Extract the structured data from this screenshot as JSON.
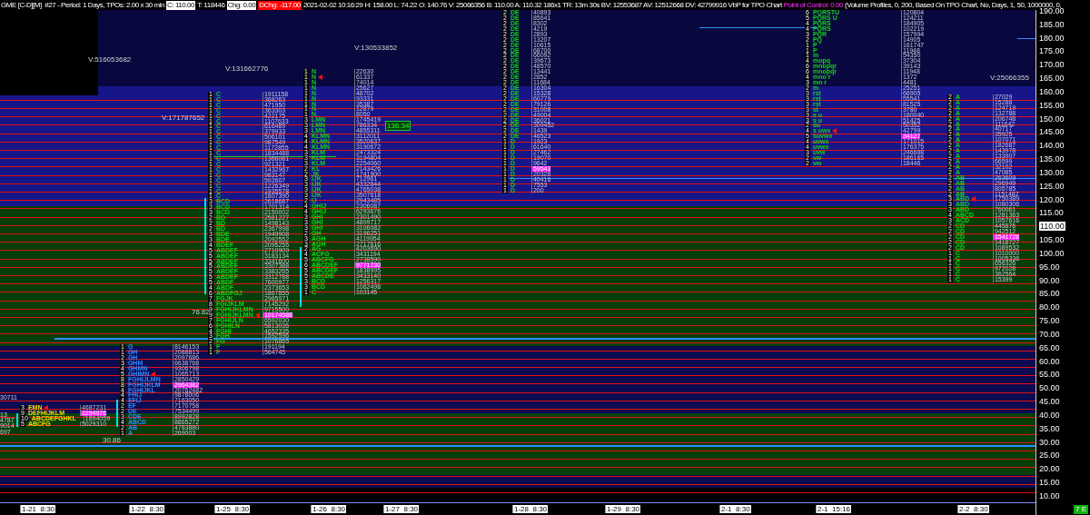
{
  "header": {
    "symbol": "GME [C-D][M]  #27 - Period: 1 Days, TPOs: 2.00 x 30 min",
    "close": "C: 110.00",
    "ticks": "T: 118446",
    "change": "Chg: 0.00",
    "day_change": "DChg: -117.00",
    "stats": "2021-02-02 10:16:29 H: 158.00 L: 74.22 O: 140.76 V: 25066356 B: 110.00 A: 110.32 186x1 TR: 13m 30s BV: 12553687 AV: 12512668 DV: 42799916 VbP for TPO Chart",
    "poc": "Point of Control: 0.00",
    "settings": "(Volume Profiles, 0, 200, Based On TPO Chart, No, Days, 1, 50, 1000000, 0,"
  },
  "left_edge_labels": [
    "30711",
    "13",
    "4787",
    "9014",
    "697"
  ],
  "profiles": [
    {
      "rows": [
        {
          "count": "3",
          "letters": "EMN",
          "volume": "4687231",
          "poc": false,
          "marker": true
        },
        {
          "count": "9",
          "letters": "DEFHIJKLM",
          "volume": "2294976",
          "poc": true,
          "marker": false
        },
        {
          "count": "10",
          "letters": "ABCDEFGHKL",
          "volume": "1894059",
          "poc": false,
          "marker": false
        },
        {
          "count": "5",
          "letters": "ABCFG",
          "volume": "5029310",
          "poc": false,
          "marker": false
        }
      ]
    },
    {
      "rows": [
        {
          "count": "1",
          "letters": "G",
          "volume": "8146153",
          "poc": false,
          "marker": false
        },
        {
          "count": "1",
          "letters": "GH",
          "volume": "2088813",
          "poc": false,
          "marker": false
        },
        {
          "count": "2",
          "letters": "GH",
          "volume": "2097686",
          "poc": false,
          "marker": false
        },
        {
          "count": "3",
          "letters": "GHM",
          "volume": "6638768",
          "poc": false,
          "marker": false
        },
        {
          "count": "4",
          "letters": "GHMN",
          "volume": "9306798",
          "poc": false,
          "marker": false
        },
        {
          "count": "5",
          "letters": "GHIMN",
          "volume": "1065713",
          "poc": false,
          "marker": true
        },
        {
          "count": "8",
          "letters": "FGHIJLMN",
          "volume": "2850429",
          "poc": false,
          "marker": false
        },
        {
          "count": "8",
          "letters": "FGHIJKLM",
          "volume": "2964382",
          "poc": true,
          "marker": false
        },
        {
          "count": "4",
          "letters": "FGHIJKL",
          "volume": "20762482",
          "poc": false,
          "marker": false
        },
        {
          "count": "4",
          "letters": "FHIJ",
          "volume": "9878006",
          "poc": false,
          "marker": false
        },
        {
          "count": "4",
          "letters": "EFIJ",
          "volume": "7163050",
          "poc": false,
          "marker": false
        },
        {
          "count": "2",
          "letters": "EF",
          "volume": "7170758",
          "poc": false,
          "marker": false
        },
        {
          "count": "2",
          "letters": "DE",
          "volume": "7534499",
          "poc": false,
          "marker": false
        },
        {
          "count": "3",
          "letters": "CDE",
          "volume": "8992828",
          "poc": false,
          "marker": false
        },
        {
          "count": "4",
          "letters": "ABCD",
          "volume": "8865272",
          "poc": false,
          "marker": false
        },
        {
          "count": "2",
          "letters": "AB",
          "volume": "4783880",
          "poc": false,
          "marker": false
        },
        {
          "count": "1",
          "letters": "A",
          "volume": "269003",
          "poc": false,
          "marker": false
        }
      ]
    },
    {
      "rows": [
        {
          "count": "1",
          "letters": "C",
          "volume": "1911158",
          "poc": false,
          "marker": false
        },
        {
          "count": "1",
          "letters": "C",
          "volume": "368263",
          "poc": false,
          "marker": false
        },
        {
          "count": "1",
          "letters": "C",
          "volume": "471950",
          "poc": false,
          "marker": false
        },
        {
          "count": "1",
          "letters": "C",
          "volume": "363303",
          "poc": false,
          "marker": false
        },
        {
          "count": "1",
          "letters": "C",
          "volume": "422175",
          "poc": false,
          "marker": false
        },
        {
          "count": "1",
          "letters": "C",
          "volume": "1107633",
          "poc": false,
          "marker": false
        },
        {
          "count": "1",
          "letters": "C",
          "volume": "616489",
          "poc": false,
          "marker": false
        },
        {
          "count": "1",
          "letters": "C",
          "volume": "379933",
          "poc": false,
          "marker": false
        },
        {
          "count": "1",
          "letters": "C",
          "volume": "506101",
          "poc": false,
          "marker": false
        },
        {
          "count": "1",
          "letters": "C",
          "volume": "987549",
          "poc": false,
          "marker": false
        },
        {
          "count": "1",
          "letters": "C",
          "volume": "1172855",
          "poc": false,
          "marker": false
        },
        {
          "count": "1",
          "letters": "C",
          "volume": "1834488",
          "poc": false,
          "marker": false
        },
        {
          "count": "1",
          "letters": "C",
          "volume": "1366081",
          "poc": false,
          "marker": false
        },
        {
          "count": "1",
          "letters": "C",
          "volume": "921321",
          "poc": false,
          "marker": false
        },
        {
          "count": "1",
          "letters": "C",
          "volume": "1432967",
          "poc": false,
          "marker": false
        },
        {
          "count": "1",
          "letters": "C",
          "volume": "983147",
          "poc": false,
          "marker": false
        },
        {
          "count": "1",
          "letters": "C",
          "volume": "592607",
          "poc": false,
          "marker": false
        },
        {
          "count": "1",
          "letters": "C",
          "volume": "1226349",
          "poc": false,
          "marker": false
        },
        {
          "count": "1",
          "letters": "C",
          "volume": "1935578",
          "poc": false,
          "marker": false
        },
        {
          "count": "1",
          "letters": "C",
          "volume": "1807390",
          "poc": false,
          "marker": false
        },
        {
          "count": "3",
          "letters": "BCD",
          "volume": "2618687",
          "poc": false,
          "marker": false
        },
        {
          "count": "3",
          "letters": "BCD",
          "volume": "1701314",
          "poc": false,
          "marker": false
        },
        {
          "count": "3",
          "letters": "BCD",
          "volume": "2150002",
          "poc": false,
          "marker": false
        },
        {
          "count": "2",
          "letters": "BD",
          "volume": "2581227",
          "poc": false,
          "marker": false
        },
        {
          "count": "2",
          "letters": "BD",
          "volume": "1498143",
          "poc": false,
          "marker": false
        },
        {
          "count": "2",
          "letters": "BD",
          "volume": "2367998",
          "poc": false,
          "marker": false
        },
        {
          "count": "3",
          "letters": "BDE",
          "volume": "1949908",
          "poc": false,
          "marker": false
        },
        {
          "count": "3",
          "letters": "BDE",
          "volume": "2092552",
          "poc": false,
          "marker": false
        },
        {
          "count": "4",
          "letters": "BDEF",
          "volume": "2095255",
          "poc": false,
          "marker": false
        },
        {
          "count": "5",
          "letters": "ABDEF",
          "volume": "2710909",
          "poc": false,
          "marker": false
        },
        {
          "count": "5",
          "letters": "ABDEF",
          "volume": "3183134",
          "poc": false,
          "marker": false
        },
        {
          "count": "5",
          "letters": "ABDEF",
          "volume": "3341600",
          "poc": false,
          "marker": false
        },
        {
          "count": "5",
          "letters": "ABDEF",
          "volume": "3307388",
          "poc": false,
          "marker": false
        },
        {
          "count": "5",
          "letters": "ABDEF",
          "volume": "3383265",
          "poc": false,
          "marker": false
        },
        {
          "count": "5",
          "letters": "ABDEF",
          "volume": "3312788",
          "poc": false,
          "marker": false
        },
        {
          "count": "5",
          "letters": "ABDF",
          "volume": "7600977",
          "poc": false,
          "marker": false
        },
        {
          "count": "4",
          "letters": "ABDF",
          "volume": "2373653",
          "poc": false,
          "marker": false
        },
        {
          "count": "6",
          "letters": "ABDFGJ",
          "volume": "1867855",
          "poc": false,
          "marker": false
        },
        {
          "count": "7",
          "letters": "FGJK",
          "volume": "2965971",
          "poc": false,
          "marker": false
        },
        {
          "count": "8",
          "letters": "FGIJKLM",
          "volume": "7145292",
          "poc": false,
          "marker": false
        },
        {
          "count": "9",
          "letters": "FGHIJKLMN",
          "volume": "9715500",
          "poc": false,
          "marker": false
        },
        {
          "count": "9",
          "letters": "FGHIJKLMN",
          "volume": "10174588",
          "poc": true,
          "marker": true
        },
        {
          "count": "7",
          "letters": "FGHIJLN",
          "volume": "6592030",
          "poc": false,
          "marker": false
        },
        {
          "count": "6",
          "letters": "FGHILN",
          "volume": "5813036",
          "poc": false,
          "marker": false
        },
        {
          "count": "4",
          "letters": "FGHI",
          "volume": "4652335",
          "poc": false,
          "marker": false
        },
        {
          "count": "3",
          "letters": "FGH",
          "volume": "1592596",
          "poc": false,
          "marker": false
        },
        {
          "count": "2",
          "letters": "FG",
          "volume": "1076865",
          "poc": false,
          "marker": false
        },
        {
          "count": "1",
          "letters": "F",
          "volume": "191194",
          "poc": false,
          "marker": false
        },
        {
          "count": "1",
          "letters": "F",
          "volume": "564745",
          "poc": false,
          "marker": false
        }
      ]
    },
    {
      "rows": [
        {
          "count": "1",
          "letters": "N",
          "volume": "22630",
          "poc": false,
          "marker": false
        },
        {
          "count": "1",
          "letters": "N",
          "volume": "61337",
          "poc": false,
          "marker": true
        },
        {
          "count": "1",
          "letters": "N",
          "volume": "74014",
          "poc": false,
          "marker": false
        },
        {
          "count": "1",
          "letters": "N",
          "volume": "25627",
          "poc": false,
          "marker": false
        },
        {
          "count": "1",
          "letters": "N",
          "volume": "48702",
          "poc": false,
          "marker": false
        },
        {
          "count": "1",
          "letters": "N",
          "volume": "93331",
          "poc": false,
          "marker": false
        },
        {
          "count": "1",
          "letters": "N",
          "volume": "35387",
          "poc": false,
          "marker": false
        },
        {
          "count": "1",
          "letters": "N",
          "volume": "12879",
          "poc": false,
          "marker": false
        },
        {
          "count": "1",
          "letters": "N",
          "volume": "8050",
          "poc": false,
          "marker": false
        },
        {
          "count": "3",
          "letters": "LMN",
          "volume": "1745419",
          "poc": false,
          "marker": false
        },
        {
          "count": "3",
          "letters": "LMN",
          "volume": "786334",
          "poc": false,
          "marker": false
        },
        {
          "count": "3",
          "letters": "LMN",
          "volume": "4855311",
          "poc": false,
          "marker": false
        },
        {
          "count": "4",
          "letters": "KLMN",
          "volume": "3112011",
          "poc": false,
          "marker": false
        },
        {
          "count": "4",
          "letters": "KLMN",
          "volume": "3520637",
          "poc": false,
          "marker": false
        },
        {
          "count": "4",
          "letters": "KLMN",
          "volume": "3190672",
          "poc": false,
          "marker": false
        },
        {
          "count": "3",
          "letters": "KLM",
          "volume": "2473324",
          "poc": false,
          "marker": false
        },
        {
          "count": "3",
          "letters": "KLM",
          "volume": "3194804",
          "poc": false,
          "marker": false
        },
        {
          "count": "3",
          "letters": "KLM",
          "volume": "2254060",
          "poc": false,
          "marker": false
        },
        {
          "count": "2",
          "letters": "KL",
          "volume": "2143426",
          "poc": false,
          "marker": false
        },
        {
          "count": "2",
          "letters": "JK",
          "volume": "1741900",
          "poc": false,
          "marker": false
        },
        {
          "count": "3",
          "letters": "IJK",
          "volume": "712961",
          "poc": false,
          "marker": false
        },
        {
          "count": "3",
          "letters": "IJK",
          "volume": "4332844",
          "poc": false,
          "marker": false
        },
        {
          "count": "3",
          "letters": "IJK",
          "volume": "4765038",
          "poc": false,
          "marker": false
        },
        {
          "count": "3",
          "letters": "IJK",
          "volume": "3507618",
          "poc": false,
          "marker": false
        },
        {
          "count": "2",
          "letters": "IJ",
          "volume": "2943485",
          "poc": false,
          "marker": false
        },
        {
          "count": "4",
          "letters": "GHIJ",
          "volume": "2306087",
          "poc": false,
          "marker": false
        },
        {
          "count": "4",
          "letters": "GHIJ",
          "volume": "6293676",
          "poc": false,
          "marker": false
        },
        {
          "count": "3",
          "letters": "GHI",
          "volume": "2301490",
          "poc": false,
          "marker": false
        },
        {
          "count": "3",
          "letters": "GHI",
          "volume": "4899717",
          "poc": false,
          "marker": false
        },
        {
          "count": "3",
          "letters": "GHI",
          "volume": "3106082",
          "poc": false,
          "marker": false
        },
        {
          "count": "2",
          "letters": "GH",
          "volume": "3196251",
          "poc": false,
          "marker": false
        },
        {
          "count": "3",
          "letters": "AGH",
          "volume": "4119954",
          "poc": false,
          "marker": false
        },
        {
          "count": "3",
          "letters": "AGH",
          "volume": "2717616",
          "poc": false,
          "marker": false
        },
        {
          "count": "2",
          "letters": "AG",
          "volume": "4203690",
          "poc": false,
          "marker": false
        },
        {
          "count": "4",
          "letters": "ACFG",
          "volume": "3431194",
          "poc": false,
          "marker": false
        },
        {
          "count": "5",
          "letters": "ABCFG",
          "volume": "2738590",
          "poc": false,
          "marker": false
        },
        {
          "count": "6",
          "letters": "ABCDEF",
          "volume": "9771730",
          "poc": true,
          "marker": false
        },
        {
          "count": "5",
          "letters": "ABCDEF",
          "volume": "1838995",
          "poc": false,
          "marker": false
        },
        {
          "count": "5",
          "letters": "ABCDE",
          "volume": "3433140",
          "poc": false,
          "marker": false
        },
        {
          "count": "3",
          "letters": "BCD",
          "volume": "1256317",
          "poc": false,
          "marker": false
        },
        {
          "count": "3",
          "letters": "BCD",
          "volume": "1082498",
          "poc": false,
          "marker": false
        },
        {
          "count": "1",
          "letters": "C",
          "volume": "103145",
          "poc": false,
          "marker": false
        }
      ]
    },
    {
      "rows": [
        {
          "count": "2",
          "letters": "DE",
          "volume": "40893",
          "poc": false,
          "marker": false
        },
        {
          "count": "2",
          "letters": "DE",
          "volume": "85641",
          "poc": false,
          "marker": false
        },
        {
          "count": "2",
          "letters": "DE",
          "volume": "8302",
          "poc": false,
          "marker": false
        },
        {
          "count": "2",
          "letters": "DE",
          "volume": "4219",
          "poc": false,
          "marker": false
        },
        {
          "count": "2",
          "letters": "DE",
          "volume": "2893",
          "poc": false,
          "marker": false
        },
        {
          "count": "2",
          "letters": "DE",
          "volume": "13207",
          "poc": false,
          "marker": false
        },
        {
          "count": "2",
          "letters": "DE",
          "volume": "10615",
          "poc": false,
          "marker": false
        },
        {
          "count": "2",
          "letters": "DE",
          "volume": "68700",
          "poc": false,
          "marker": false
        },
        {
          "count": "2",
          "letters": "DE",
          "volume": "66092",
          "poc": false,
          "marker": false
        },
        {
          "count": "2",
          "letters": "DE",
          "volume": "39673",
          "poc": false,
          "marker": false
        },
        {
          "count": "2",
          "letters": "DE",
          "volume": "48570",
          "poc": false,
          "marker": false
        },
        {
          "count": "2",
          "letters": "DE",
          "volume": "13441",
          "poc": false,
          "marker": false
        },
        {
          "count": "2",
          "letters": "DE",
          "volume": "2852",
          "poc": false,
          "marker": false
        },
        {
          "count": "2",
          "letters": "DE",
          "volume": "11684",
          "poc": false,
          "marker": false
        },
        {
          "count": "2",
          "letters": "DE",
          "volume": "16304",
          "poc": false,
          "marker": false
        },
        {
          "count": "2",
          "letters": "DE",
          "volume": "15328",
          "poc": false,
          "marker": false
        },
        {
          "count": "2",
          "letters": "DE",
          "volume": "60779",
          "poc": false,
          "marker": false
        },
        {
          "count": "2",
          "letters": "DE",
          "volume": "79126",
          "poc": false,
          "marker": false
        },
        {
          "count": "2",
          "letters": "DE",
          "volume": "31008",
          "poc": false,
          "marker": false
        },
        {
          "count": "2",
          "letters": "DE",
          "volume": "49004",
          "poc": false,
          "marker": false
        },
        {
          "count": "2",
          "letters": "DE",
          "volume": "36021",
          "poc": false,
          "marker": false
        },
        {
          "count": "2",
          "letters": "DE",
          "volume": "309452",
          "poc": false,
          "marker": false
        },
        {
          "count": "2",
          "letters": "DE",
          "volume": "1439",
          "poc": false,
          "marker": false
        },
        {
          "count": "2",
          "letters": "DE",
          "volume": "46523",
          "poc": false,
          "marker": false
        },
        {
          "count": "1",
          "letters": "D",
          "volume": "1923",
          "poc": false,
          "marker": false
        },
        {
          "count": "1",
          "letters": "D",
          "volume": "61640",
          "poc": false,
          "marker": false
        },
        {
          "count": "1",
          "letters": "D",
          "volume": "27462",
          "poc": false,
          "marker": false
        },
        {
          "count": "1",
          "letters": "D",
          "volume": "19070",
          "poc": false,
          "marker": false
        },
        {
          "count": "1",
          "letters": "D",
          "volume": "9642",
          "poc": false,
          "marker": false
        },
        {
          "count": "1",
          "letters": "D",
          "volume": "59543",
          "poc": true,
          "marker": false
        },
        {
          "count": "1",
          "letters": "D",
          "volume": "20328",
          "poc": false,
          "marker": false
        },
        {
          "count": "1",
          "letters": "D",
          "volume": "40416",
          "poc": false,
          "marker": false
        },
        {
          "count": "1",
          "letters": "D",
          "volume": "7553",
          "poc": false,
          "marker": false
        },
        {
          "count": "1",
          "letters": "D",
          "volume": "200",
          "poc": false,
          "marker": false
        }
      ]
    },
    {
      "rows": [
        {
          "count": "6",
          "letters": "PQRSTU",
          "volume": "120804",
          "poc": false,
          "marker": false
        },
        {
          "count": "5",
          "letters": "PQRS U",
          "volume": "124211",
          "poc": false,
          "marker": false
        },
        {
          "count": "4",
          "letters": "PQRS",
          "volume": "184905",
          "poc": false,
          "marker": false
        },
        {
          "count": "4",
          "letters": "PQRS",
          "volume": "102219",
          "poc": false,
          "marker": false
        },
        {
          "count": "3",
          "letters": "PQR",
          "volume": "157994",
          "poc": false,
          "marker": false
        },
        {
          "count": "2",
          "letters": "PQ",
          "volume": "14905",
          "poc": false,
          "marker": false
        },
        {
          "count": "1",
          "letters": "P",
          "volume": "161747",
          "poc": false,
          "marker": false
        },
        {
          "count": "1",
          "letters": "P",
          "volume": "11948",
          "poc": false,
          "marker": false
        },
        {
          "count": "1",
          "letters": "m",
          "volume": "54350",
          "poc": false,
          "marker": false
        },
        {
          "count": "4",
          "letters": "mopq",
          "volume": "37304",
          "poc": false,
          "marker": false
        },
        {
          "count": "6",
          "letters": "mnopqr",
          "volume": "39143",
          "poc": false,
          "marker": false
        },
        {
          "count": "6",
          "letters": "mnopqr",
          "volume": "11948",
          "poc": false,
          "marker": false
        },
        {
          "count": "4",
          "letters": "mno r",
          "volume": "1372",
          "poc": false,
          "marker": false
        },
        {
          "count": "3",
          "letters": "mn r",
          "volume": "4481",
          "poc": false,
          "marker": false
        },
        {
          "count": "2",
          "letters": "m",
          "volume": "25251",
          "poc": false,
          "marker": false
        },
        {
          "count": "3",
          "letters": "rst",
          "volume": "66905",
          "poc": false,
          "marker": false
        },
        {
          "count": "3",
          "letters": "rst",
          "volume": "55541",
          "poc": false,
          "marker": false
        },
        {
          "count": "3",
          "letters": "rst",
          "volume": "81525",
          "poc": false,
          "marker": false
        },
        {
          "count": "3",
          "letters": "st",
          "volume": "3780",
          "poc": false,
          "marker": false
        },
        {
          "count": "3",
          "letters": "s u",
          "volume": "180040",
          "poc": false,
          "marker": false
        },
        {
          "count": "3",
          "letters": "s u",
          "volume": "51425",
          "poc": false,
          "marker": false
        },
        {
          "count": "2",
          "letters": "su",
          "volume": "50352",
          "poc": false,
          "marker": false
        },
        {
          "count": "4",
          "letters": "s uwx",
          "volume": "42799",
          "poc": false,
          "marker": true
        },
        {
          "count": "5",
          "letters": "suvwx",
          "volume": "34127",
          "poc": true,
          "marker": false
        },
        {
          "count": "4",
          "letters": "uvwx",
          "volume": "171015",
          "poc": false,
          "marker": false
        },
        {
          "count": "4",
          "letters": "uvwx",
          "volume": "176375",
          "poc": false,
          "marker": false
        },
        {
          "count": "3",
          "letters": "uvw",
          "volume": "246688",
          "poc": false,
          "marker": false
        },
        {
          "count": "2",
          "letters": "vw",
          "volume": "186165",
          "poc": false,
          "marker": false
        },
        {
          "count": "2",
          "letters": "vw",
          "volume": "18446",
          "poc": false,
          "marker": false
        }
      ]
    },
    {
      "rows": [
        {
          "count": "2",
          "letters": "A",
          "volume": "27029",
          "poc": false,
          "marker": false
        },
        {
          "count": "2",
          "letters": "A",
          "volume": "15288",
          "poc": false,
          "marker": false
        },
        {
          "count": "2",
          "letters": "A",
          "volume": "124719",
          "poc": false,
          "marker": false
        },
        {
          "count": "2",
          "letters": "A",
          "volume": "132788",
          "poc": false,
          "marker": false
        },
        {
          "count": "2",
          "letters": "A",
          "volume": "206748",
          "poc": false,
          "marker": false
        },
        {
          "count": "2",
          "letters": "A",
          "volume": "111642",
          "poc": false,
          "marker": false
        },
        {
          "count": "2",
          "letters": "A",
          "volume": "40717",
          "poc": false,
          "marker": false
        },
        {
          "count": "2",
          "letters": "A",
          "volume": "35925",
          "poc": false,
          "marker": false
        },
        {
          "count": "2",
          "letters": "A",
          "volume": "107071",
          "poc": false,
          "marker": false
        },
        {
          "count": "2",
          "letters": "A",
          "volume": "182687",
          "poc": false,
          "marker": false
        },
        {
          "count": "2",
          "letters": "A",
          "volume": "143978",
          "poc": false,
          "marker": false
        },
        {
          "count": "2",
          "letters": "A",
          "volume": "133907",
          "poc": false,
          "marker": false
        },
        {
          "count": "2",
          "letters": "A",
          "volume": "66599",
          "poc": false,
          "marker": false
        },
        {
          "count": "2",
          "letters": "A",
          "volume": "32102",
          "poc": false,
          "marker": false
        },
        {
          "count": "2",
          "letters": "A",
          "volume": "47085",
          "poc": false,
          "marker": false
        },
        {
          "count": "2",
          "letters": "AB",
          "volume": "263609",
          "poc": false,
          "marker": false
        },
        {
          "count": "2",
          "letters": "AB",
          "volume": "296949",
          "poc": false,
          "marker": false
        },
        {
          "count": "2",
          "letters": "AB",
          "volume": "805785",
          "poc": false,
          "marker": false
        },
        {
          "count": "2",
          "letters": "AB",
          "volume": "1151482",
          "poc": false,
          "marker": false
        },
        {
          "count": "3",
          "letters": "ABD",
          "volume": "1750389",
          "poc": false,
          "marker": true
        },
        {
          "count": "3",
          "letters": "ABD",
          "volume": "1080306",
          "poc": false,
          "marker": false
        },
        {
          "count": "3",
          "letters": "ABD",
          "volume": "760061",
          "poc": false,
          "marker": false
        },
        {
          "count": "4",
          "letters": "ABCD",
          "volume": "1281363",
          "poc": false,
          "marker": false
        },
        {
          "count": "3",
          "letters": "ACD",
          "volume": "1057616",
          "poc": false,
          "marker": false
        },
        {
          "count": "2",
          "letters": "CD",
          "volume": "445876",
          "poc": false,
          "marker": false
        },
        {
          "count": "2",
          "letters": "CD",
          "volume": "942512",
          "poc": false,
          "marker": false
        },
        {
          "count": "2",
          "letters": "CD",
          "volume": "1541728",
          "poc": true,
          "marker": false
        },
        {
          "count": "2",
          "letters": "CD",
          "volume": "1418727",
          "poc": false,
          "marker": false
        },
        {
          "count": "2",
          "letters": "CD",
          "volume": "1089532",
          "poc": false,
          "marker": false
        },
        {
          "count": "1",
          "letters": "C",
          "volume": "1010000",
          "poc": false,
          "marker": false
        },
        {
          "count": "1",
          "letters": "C",
          "volume": "1005336",
          "poc": false,
          "marker": false
        },
        {
          "count": "1",
          "letters": "C",
          "volume": "656326",
          "poc": false,
          "marker": false
        },
        {
          "count": "1",
          "letters": "C",
          "volume": "972028",
          "poc": false,
          "marker": false
        },
        {
          "count": "1",
          "letters": "C",
          "volume": "362564",
          "poc": false,
          "marker": false
        },
        {
          "count": "1",
          "letters": "C",
          "volume": "15399",
          "poc": false,
          "marker": false
        }
      ]
    }
  ],
  "volume_labels": [
    "V:516053682",
    "V:171787652",
    "V:131662776",
    "V:130533852",
    "V:25066355"
  ],
  "price_labels": [
    "30.86",
    "76.62",
    "136.34"
  ],
  "price_axis": [
    {
      "label": "190.00",
      "current": false
    },
    {
      "label": "185.00",
      "current": false
    },
    {
      "label": "180.00",
      "current": false
    },
    {
      "label": "175.00",
      "current": false
    },
    {
      "label": "170.00",
      "current": false
    },
    {
      "label": "165.00",
      "current": false
    },
    {
      "label": "160.00",
      "current": false
    },
    {
      "label": "155.00",
      "current": false
    },
    {
      "label": "150.00",
      "current": false
    },
    {
      "label": "145.00",
      "current": false
    },
    {
      "label": "140.00",
      "current": false
    },
    {
      "label": "135.00",
      "current": false
    },
    {
      "label": "130.00",
      "current": false
    },
    {
      "label": "125.00",
      "current": false
    },
    {
      "label": "120.00",
      "current": false
    },
    {
      "label": "115.00",
      "current": false
    },
    {
      "label": "110.00",
      "current": true
    },
    {
      "label": "105.00",
      "current": false
    },
    {
      "label": "100.00",
      "current": false
    },
    {
      "label": "95.00",
      "current": false
    },
    {
      "label": "90.00",
      "current": false
    },
    {
      "label": "85.00",
      "current": false
    },
    {
      "label": "80.00",
      "current": false
    },
    {
      "label": "75.00",
      "current": false
    },
    {
      "label": "70.00",
      "current": false
    },
    {
      "label": "65.00",
      "current": false
    },
    {
      "label": "60.00",
      "current": false
    },
    {
      "label": "55.00",
      "current": false
    },
    {
      "label": "50.00",
      "current": false
    },
    {
      "label": "45.00",
      "current": false
    },
    {
      "label": "40.00",
      "current": false
    },
    {
      "label": "35.00",
      "current": false
    },
    {
      "label": "30.00",
      "current": false
    },
    {
      "label": "25.00",
      "current": false
    },
    {
      "label": "20.00",
      "current": false
    },
    {
      "label": "15.00",
      "current": false
    },
    {
      "label": "10.00",
      "current": false
    }
  ],
  "time_axis": [
    "1-21  8:30",
    "1-22  8:30",
    "1-25  8:30",
    "1-26  8:30",
    "1-27  8:30",
    "1-28  8:30",
    "1-29  8:30",
    "2-1  8:30",
    "2-1  15:16",
    "2-2  8:30"
  ],
  "corner_badge": "7 E"
}
